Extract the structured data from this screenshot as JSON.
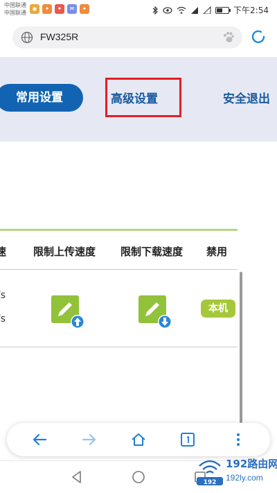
{
  "status_bar": {
    "carrier_1": "中国联通",
    "carrier_2": "中国联通",
    "time": "下午2:54",
    "notification_icons": [
      "weibo-icon",
      "app-icon",
      "app-icon",
      "mail-icon",
      "app-icon"
    ],
    "system_icons": [
      "bluetooth-icon",
      "eye-icon",
      "wifi-icon",
      "signal-icon",
      "signal-icon",
      "battery-icon"
    ]
  },
  "browser": {
    "url": "FW325R"
  },
  "router_nav": {
    "tab_common": "常用设置",
    "tab_advanced": "高级设置",
    "tab_logout": "安全退出",
    "highlight_color": "#e21e26",
    "active_color": "#1264b2"
  },
  "table": {
    "headers": {
      "speed": "速",
      "upload_limit": "限制上传速度",
      "download_limit": "限制下载速度",
      "disable": "禁用"
    },
    "rows": [
      {
        "speed_up": "/s",
        "speed_down": "/s",
        "badge": "本机"
      }
    ]
  },
  "watermark": {
    "title": "192路由网",
    "url": "192ly.com",
    "logo_text": "192"
  }
}
